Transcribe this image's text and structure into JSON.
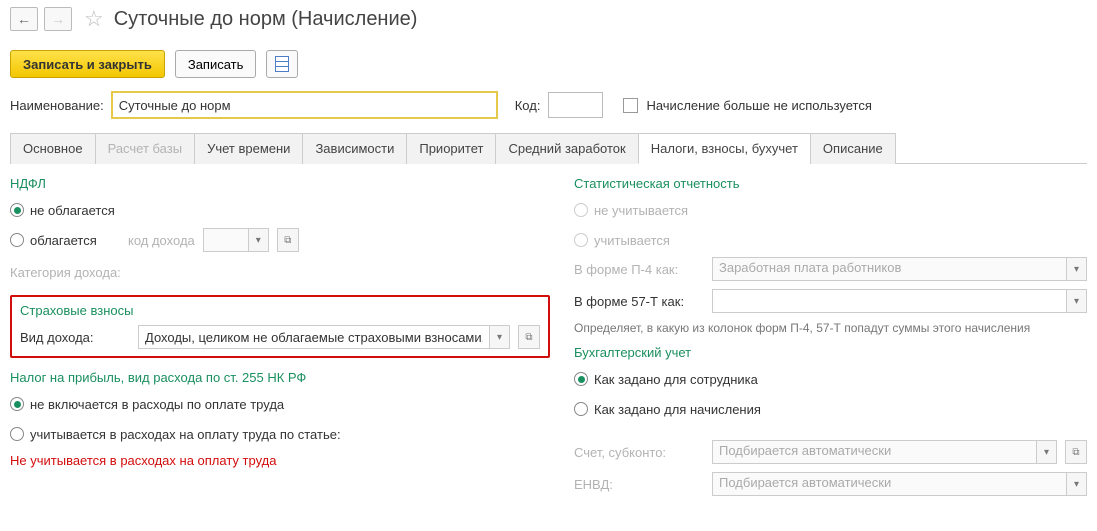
{
  "header": {
    "title": "Суточные до норм (Начисление)"
  },
  "toolbar": {
    "save_close": "Записать и закрыть",
    "save": "Записать"
  },
  "fields": {
    "name_label": "Наименование:",
    "name_value": "Суточные до норм",
    "code_label": "Код:",
    "code_value": "",
    "not_used_label": "Начисление больше не используется"
  },
  "tabs": [
    {
      "label": "Основное",
      "active": false,
      "disabled": false
    },
    {
      "label": "Расчет базы",
      "active": false,
      "disabled": true
    },
    {
      "label": "Учет времени",
      "active": false,
      "disabled": false
    },
    {
      "label": "Зависимости",
      "active": false,
      "disabled": false
    },
    {
      "label": "Приоритет",
      "active": false,
      "disabled": false
    },
    {
      "label": "Средний заработок",
      "active": false,
      "disabled": false
    },
    {
      "label": "Налоги, взносы, бухучет",
      "active": true,
      "disabled": false
    },
    {
      "label": "Описание",
      "active": false,
      "disabled": false
    }
  ],
  "ndfl": {
    "title": "НДФЛ",
    "not_taxed": "не облагается",
    "taxed": "облагается",
    "income_code_label": "код дохода",
    "category_label": "Категория дохода:"
  },
  "insurance": {
    "title": "Страховые взносы",
    "kind_label": "Вид дохода:",
    "kind_value": "Доходы, целиком не облагаемые страховыми взносами, кроме пособий за счет ФСС и денежного довольствия военнослужащих"
  },
  "profit_tax": {
    "title": "Налог на прибыль, вид расхода по ст. 255 НК РФ",
    "opt1": "не включается в расходы по оплате труда",
    "opt2": "учитывается в расходах на оплату труда по статье:",
    "red_note": "Не учитывается в расходах на оплату труда"
  },
  "stats": {
    "title": "Статистическая отчетность",
    "not_counted": "не учитывается",
    "counted": "учитывается",
    "p4_label": "В форме П-4 как:",
    "p4_value": "Заработная плата работников",
    "t57_label": "В форме 57-Т как:",
    "hint": "Определяет, в какую из колонок форм П-4, 57-Т попадут суммы этого начисления"
  },
  "accounting": {
    "title": "Бухгалтерский учет",
    "opt1": "Как задано для сотрудника",
    "opt2": "Как задано для начисления",
    "acct_label": "Счет, субконто:",
    "acct_placeholder": "Подбирается автоматически",
    "envd_label": "ЕНВД:",
    "envd_placeholder": "Подбирается автоматически"
  }
}
